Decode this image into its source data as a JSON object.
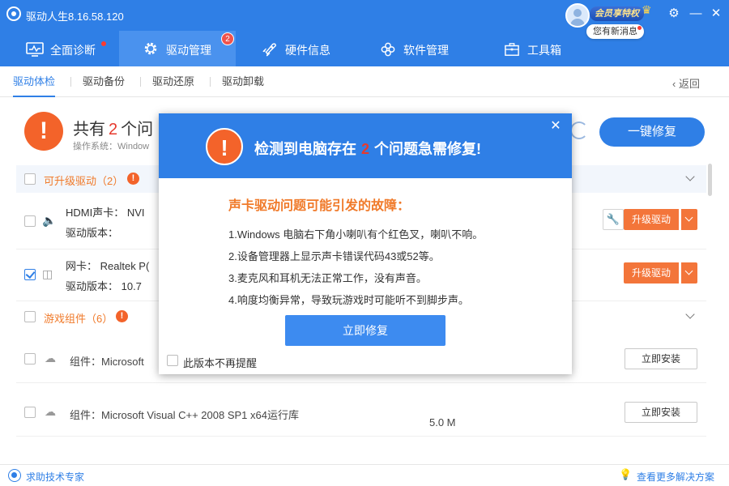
{
  "app": {
    "title": "驱动人生8.16.58.120",
    "vip_badge": "会员享特权",
    "message_bubble": "您有新消息"
  },
  "nav": {
    "items": [
      {
        "label": "全面诊断",
        "icon": "monitor-icon"
      },
      {
        "label": "驱动管理",
        "icon": "gear-icon",
        "badge": "2"
      },
      {
        "label": "硬件信息",
        "icon": "rocket-icon"
      },
      {
        "label": "软件管理",
        "icon": "flower-icon"
      },
      {
        "label": "工具箱",
        "icon": "toolbox-icon"
      }
    ]
  },
  "subnav": {
    "tabs": [
      "驱动体检",
      "驱动备份",
      "驱动还原",
      "驱动卸载"
    ],
    "back": "返回"
  },
  "summary": {
    "title_prefix": "共有",
    "count": "2",
    "title_suffix": "个问",
    "os_label": "操作系统：Window",
    "fix_all_button": "一键修复"
  },
  "groups": [
    {
      "title": "可升级驱动（2）"
    },
    {
      "title": "游戏组件（6）"
    }
  ],
  "driver_rows": [
    {
      "name": "HDMI声卡：  NVI",
      "version": "驱动版本：",
      "action": "升级驱动",
      "checked": false,
      "icon": "speaker-icon"
    },
    {
      "name": "网卡：  Realtek P(",
      "version": "驱动版本：    10.7",
      "action": "升级驱动",
      "checked": true,
      "icon": "network-icon"
    }
  ],
  "component_rows": [
    {
      "name": "组件：Microsoft",
      "size": "",
      "action": "立即安装"
    },
    {
      "name": "组件：Microsoft Visual C++ 2008 SP1 x64运行库",
      "size": "5.0 M",
      "action": "立即安装"
    }
  ],
  "bottom": {
    "help": "求助技术专家",
    "more": "查看更多解决方案"
  },
  "dialog": {
    "title_prefix": "检测到电脑存在",
    "count": "2",
    "title_suffix": "个问题急需修复!",
    "subtitle": "声卡驱动问题可能引发的故障：",
    "items": [
      "1.Windows 电脑右下角小喇叭有个红色叉，喇叭不响。",
      "2.设备管理器上显示声卡错误代码43或52等。",
      "3.麦克风和耳机无法正常工作，没有声音。",
      "4.响度均衡异常，导致玩游戏时可能听不到脚步声。"
    ],
    "fix_button": "立即修复",
    "dont_remind": "此版本不再提醒"
  },
  "colors": {
    "brand_blue": "#2f7fe6",
    "warning_orange": "#f3632a",
    "count_red": "#e63a2e"
  }
}
